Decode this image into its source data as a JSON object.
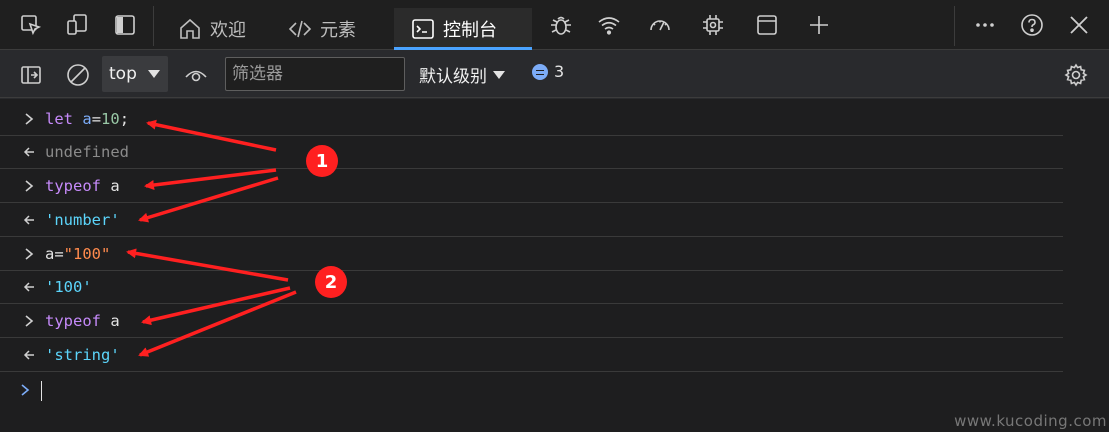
{
  "tabs": [
    {
      "label": "欢迎",
      "icon": "home-icon",
      "active": false
    },
    {
      "label": "元素",
      "icon": "code-icon",
      "active": false
    },
    {
      "label": "控制台",
      "icon": "console-icon",
      "active": true
    }
  ],
  "toolbar": {
    "context": "top",
    "filter_placeholder": "筛选器",
    "levels": "默认级别",
    "issues_count": "3"
  },
  "console": {
    "row1": {
      "kw": "let",
      "var": "a",
      "eq": "=",
      "num": "10",
      "semi": ";"
    },
    "row2": {
      "text": "undefined"
    },
    "row3": {
      "kw": "typeof",
      "rest": " a"
    },
    "row4": {
      "text": "'number'"
    },
    "row5": {
      "pre": "a=",
      "str": "\"100\""
    },
    "row6": {
      "text": "'100'"
    },
    "row7": {
      "kw": "typeof",
      "rest": " a"
    },
    "row8": {
      "text": "'string'"
    }
  },
  "annotations": {
    "badge1": "1",
    "badge2": "2",
    "color": "#ff2020"
  },
  "watermark": "www.kucoding.com",
  "colors": {
    "accent": "#4aa3ff",
    "keyword": "#c58af9",
    "variable": "#7cacf8",
    "number": "#99c8a6",
    "string_input": "#ff8b4d",
    "string_result": "#5cd5fb",
    "muted": "#8b8b8b"
  }
}
